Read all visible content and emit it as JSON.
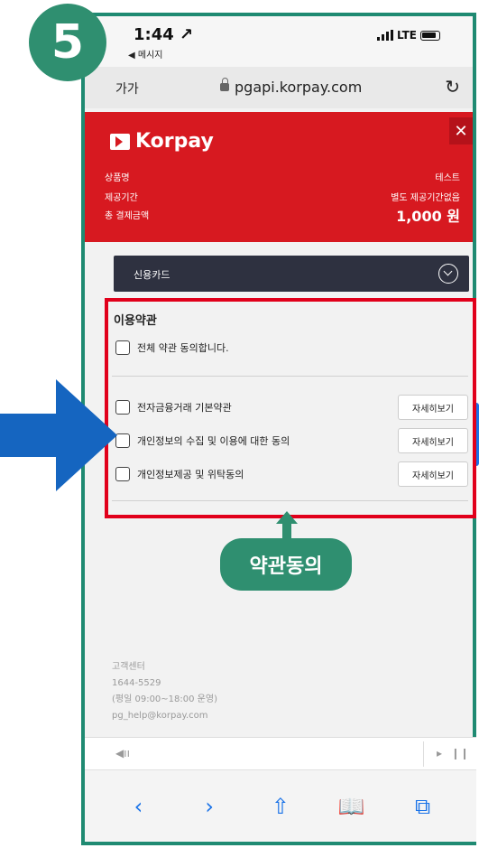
{
  "badge": {
    "step": "5"
  },
  "status_bar": {
    "time": "1:44 ↗",
    "back_app": "◀ 메시지",
    "network": "LTE"
  },
  "address_bar": {
    "text_size": "가가",
    "url": "pgapi.korpay.com",
    "reload": "↻"
  },
  "header": {
    "brand": "Korpay",
    "close": "✕",
    "rows": [
      {
        "label": "상품명",
        "value": "테스트"
      },
      {
        "label": "제공기간",
        "value": "별도 제공기간없음"
      },
      {
        "label": "총 결제금액",
        "value": "1,000 원"
      }
    ]
  },
  "payment_method": {
    "label": "신용카드"
  },
  "terms": {
    "title": "이용약관",
    "agree_all": "전체 약관 동의합니다.",
    "items": [
      {
        "label": "전자금융거래 기본약관",
        "detail": "자세히보기"
      },
      {
        "label": "개인정보의 수집 및 이용에 대한 동의",
        "detail": "자세히보기"
      },
      {
        "label": "개인정보제공 및 위탁동의",
        "detail": "자세히보기"
      }
    ]
  },
  "callout": {
    "text": "약관동의"
  },
  "footer": {
    "lines": [
      "고객센터",
      "1644-5529",
      "(평일 09:00~18:00 운영)",
      "pg_help@korpay.com"
    ]
  },
  "media_bar": {
    "speaker": "◀ıı",
    "play": "▸",
    "pause": "❙❙"
  },
  "toolbar": {
    "back": "‹",
    "forward": "›",
    "share": "⇧",
    "bookmarks": "📖",
    "tabs": "⧉"
  },
  "colors": {
    "accent_green": "#2f8f70",
    "brand_red": "#d71920",
    "highlight_red": "#e1001b",
    "arrow_blue": "#1565c0"
  }
}
